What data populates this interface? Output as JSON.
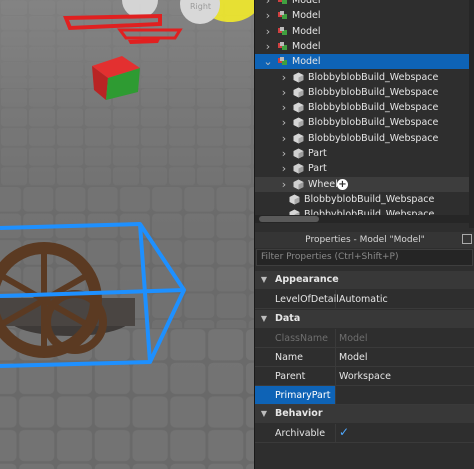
{
  "explorer": {
    "rows": [
      {
        "label": "Model",
        "icon": "model-icon",
        "chevron": ">",
        "state": ""
      },
      {
        "label": "Model",
        "icon": "model-icon",
        "chevron": ">",
        "state": ""
      },
      {
        "label": "Model",
        "icon": "model-icon",
        "chevron": ">",
        "state": ""
      },
      {
        "label": "Model",
        "icon": "model-icon",
        "chevron": ">",
        "state": ""
      },
      {
        "label": "Model",
        "icon": "model-icon",
        "chevron": "v",
        "state": "selected"
      },
      {
        "label": "BlobbyblobBuild_Webspace",
        "icon": "mesh-icon",
        "chevron": ">",
        "state": ""
      },
      {
        "label": "BlobbyblobBuild_Webspace",
        "icon": "mesh-icon",
        "chevron": ">",
        "state": ""
      },
      {
        "label": "BlobbyblobBuild_Webspace",
        "icon": "mesh-icon",
        "chevron": ">",
        "state": ""
      },
      {
        "label": "BlobbyblobBuild_Webspace",
        "icon": "mesh-icon",
        "chevron": ">",
        "state": ""
      },
      {
        "label": "BlobbyblobBuild_Webspace",
        "icon": "mesh-icon",
        "chevron": ">",
        "state": ""
      },
      {
        "label": "Part",
        "icon": "part-icon",
        "chevron": ">",
        "state": ""
      },
      {
        "label": "Part",
        "icon": "part-icon",
        "chevron": ">",
        "state": ""
      },
      {
        "label": "Wheel",
        "icon": "part-icon",
        "chevron": ">",
        "state": "hover"
      },
      {
        "label": "BlobbyblobBuild_Webspace",
        "icon": "mesh-icon",
        "chevron": "",
        "state": ""
      },
      {
        "label": "BlobbyblobBuild_Webspace",
        "icon": "mesh-icon",
        "chevron": "",
        "state": ""
      }
    ]
  },
  "properties": {
    "title": "Properties - Model \"Model\"",
    "filter_placeholder": "Filter Properties (Ctrl+Shift+P)",
    "sections": {
      "appearance": "Appearance",
      "data": "Data",
      "behavior": "Behavior"
    },
    "rows": {
      "level_of_detail": {
        "name": "LevelOfDetail",
        "value": "Automatic"
      },
      "class_name": {
        "name": "ClassName",
        "value": "Model"
      },
      "name": {
        "name": "Name",
        "value": "Model"
      },
      "parent": {
        "name": "Parent",
        "value": "Workspace"
      },
      "primary_part": {
        "name": "PrimaryPart",
        "value": ""
      },
      "archivable": {
        "name": "Archivable",
        "checked": true
      }
    }
  },
  "viewport": {
    "camera_label": "Right"
  },
  "colors": {
    "selection": "#0e63b6",
    "selection_box": "#1e90ff",
    "red_part": "#e02020",
    "green_part": "#2e9b32"
  }
}
